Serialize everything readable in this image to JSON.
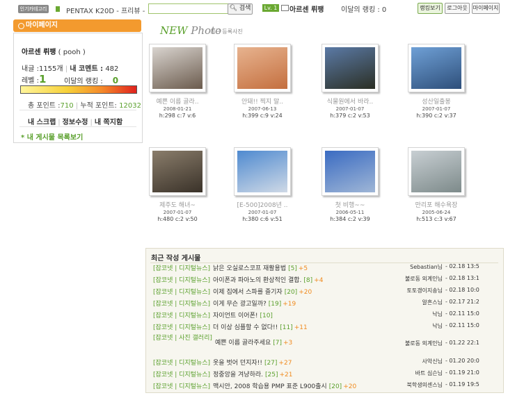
{
  "topbar": {
    "hot_tag": "인기카테고리",
    "ticker": "PENTAX K20D - 프리뷰 -",
    "search_placeholder": "",
    "search_button": "검색",
    "level_badge": "Lv. 1",
    "username": "아르센 뤼팽",
    "monthly_rank": "이달의 랭킹 : 0",
    "buttons": [
      "랭킹보기",
      "로그아웃",
      "마이페이지"
    ]
  },
  "sidebar": {
    "title": "마이페이지",
    "name": "아르센 뤼팽",
    "nick": "( pooh )",
    "posts_label": "내글 :",
    "posts": "1155개",
    "comments_label": "내 코멘트 :",
    "comments": "482",
    "level_label": "레벨 :",
    "level": "1",
    "month_rank_label": "이달의 랭킹 :",
    "month_rank": "0",
    "exp_fraction": 1.0,
    "total_points_label": "총 포인트 :",
    "total_points": "710",
    "accum_points_label": "누적 포인트:",
    "accum_points": "12032",
    "links": [
      "내 스크랩",
      "정보수정",
      "내 쪽지함"
    ],
    "my_board": "* 내 게시물 목록보기"
  },
  "newphoto": {
    "title_new": "NEW",
    "title_photo": "Photo",
    "subtitle": "최근 등록사진",
    "photos": [
      {
        "title": "예쁜 이름 골라..",
        "date": "2008-01-21",
        "stats": "h:298  c:7  v:6",
        "colors": [
          "#d9d4cf",
          "#6b5b4d"
        ]
      },
      {
        "title": "안돼!! 찍지 말..",
        "date": "2007-06-13",
        "stats": "h:399  c:9  v:24",
        "colors": [
          "#e7b38f",
          "#c46f3f"
        ]
      },
      {
        "title": "식물원에서 바라..",
        "date": "2007-01-07",
        "stats": "h:379  c:2  v:53",
        "colors": [
          "#5b7aa6",
          "#2b2f24"
        ]
      },
      {
        "title": "성산일출봉",
        "date": "2007-01-07",
        "stats": "h:390  c:2  v:37",
        "colors": [
          "#6fa0d6",
          "#2e4f7a"
        ]
      },
      {
        "title": "제주도 해녀~",
        "date": "2007-01-07",
        "stats": "h:480  c:2  v:50",
        "colors": [
          "#8a7d6b",
          "#3a3229"
        ]
      },
      {
        "title": "[E-500]2008년 ..",
        "date": "2007-01-07",
        "stats": "h:380  c:6  v:51",
        "colors": [
          "#4f8ad0",
          "#cfd9e6"
        ]
      },
      {
        "title": "첫 비행~~",
        "date": "2006-05-11",
        "stats": "h:384  c:2  v:39",
        "colors": [
          "#3a6bc2",
          "#9fb6d6"
        ]
      },
      {
        "title": "만리포 해수욕장",
        "date": "2005-06-24",
        "stats": "h:513  c:3  v:67",
        "colors": [
          "#c8cfd3",
          "#7d8a8a"
        ]
      }
    ]
  },
  "recent": {
    "title": "최근 작성 게시물",
    "rows": [
      {
        "cat": "[잡코넷 | 디지털뉴스]",
        "subj": "낡은 오실로스코프 재활용법",
        "cnt": "[5]",
        "plus": "+5",
        "author": "Sebastian님",
        "time": "- 02.18 13:5"
      },
      {
        "cat": "[잡코넷 | 디지털뉴스]",
        "subj": "아이폰과 파아노의 환상적인 결합.",
        "cnt": "[8]",
        "plus": "+4",
        "author": "불로동 외계인님",
        "time": "- 02.18 13:1"
      },
      {
        "cat": "[잡코넷 | 디지털뉴스]",
        "subj": "이제 집에서 스파를 즐기자",
        "cnt": "[20]",
        "plus": "+20",
        "author": "토토갱이지송님",
        "time": "- 02.18 10:0"
      },
      {
        "cat": "[잡코넷 | 디지털뉴스]",
        "subj": "이게 무슨 광고일까?",
        "cnt": "[19]",
        "plus": "+19",
        "author": "알흔스님",
        "time": "- 02.17 21:2"
      },
      {
        "cat": "[잡코넷 | 디지털뉴스]",
        "subj": "자이언트 이어폰!",
        "cnt": "[10]",
        "plus": "",
        "author": "낙님",
        "time": "- 02.11 15:0"
      },
      {
        "cat": "[잡코넷 | 디지털뉴스]",
        "subj": "더 이상 심플할 수 없다!!",
        "cnt": "[11]",
        "plus": "+11",
        "author": "낙님",
        "time": "- 02.11 15:0"
      },
      {
        "cat": "[잡코넷 | 사진 갤러리]",
        "subj": "예쁜 이름 골라주세요",
        "cnt": "[7]",
        "plus": "+3",
        "author": "불로동 외계인님",
        "time": "- 01.22 22:1"
      },
      {
        "cat": "[잡코넷 | 디지털뉴스]",
        "subj": "옷을 벗어 던지자!!",
        "cnt": "[27]",
        "plus": "+27",
        "author": "사악신님",
        "time": "- 01.20 20:0"
      },
      {
        "cat": "[잡코넷 | 디지털뉴스]",
        "subj": "정중앙을 겨냥하라.",
        "cnt": "[25]",
        "plus": "+21",
        "author": "바트 심슨님",
        "time": "- 01.19 21:0"
      },
      {
        "cat": "[잡코넷 | 디지털뉴스]",
        "subj": "맥시안, 2008 학습용 PMP 표준 L900출시",
        "cnt": "[20]",
        "plus": "+20",
        "author": "북학생의센스님",
        "time": "- 01.19 19:5"
      }
    ]
  }
}
